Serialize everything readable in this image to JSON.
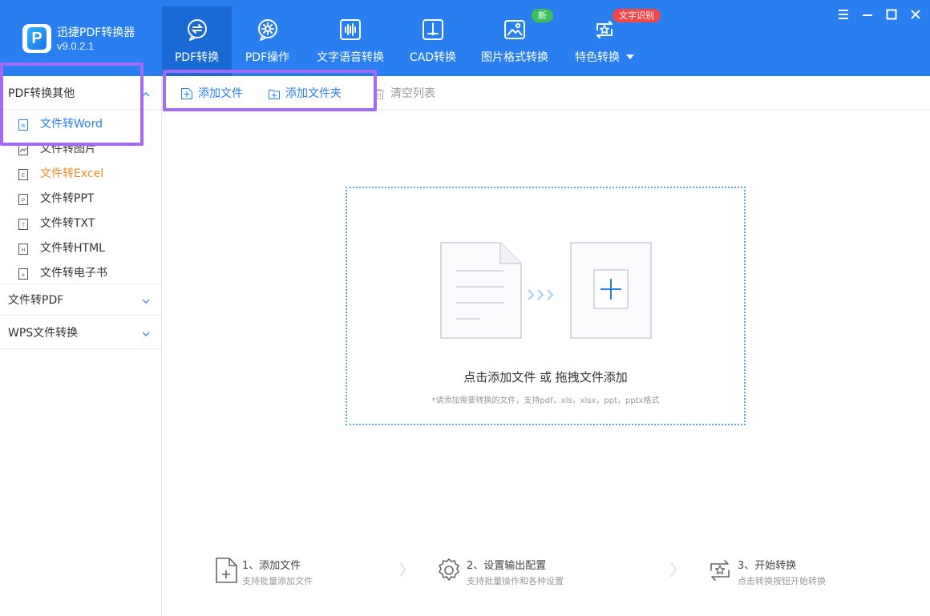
{
  "app": {
    "name": "迅捷PDF转换器",
    "version": "v9.0.2.1"
  },
  "nav": {
    "tabs": [
      {
        "label": "PDF转换",
        "active": true,
        "icon": "convert-icon"
      },
      {
        "label": "PDF操作",
        "active": false,
        "icon": "gear-icon"
      },
      {
        "label": "文字语音转换",
        "active": false,
        "icon": "audio-wave-icon"
      },
      {
        "label": "CAD转换",
        "active": false,
        "icon": "cad-icon"
      },
      {
        "label": "图片格式转换",
        "active": false,
        "icon": "image-icon",
        "badge": "新"
      },
      {
        "label": "特色转换",
        "active": false,
        "icon": "star-convert-icon",
        "badge": "文字识别",
        "dropdown": true
      }
    ]
  },
  "sidebar": {
    "groups": [
      {
        "label": "PDF转换其他",
        "expanded": true,
        "items": [
          {
            "label": "文件转Word",
            "icon": "word-doc-icon",
            "state": "selected"
          },
          {
            "label": "文件转图片",
            "icon": "image-doc-icon",
            "state": "normal"
          },
          {
            "label": "文件转Excel",
            "icon": "excel-doc-icon",
            "state": "hover"
          },
          {
            "label": "文件转PPT",
            "icon": "ppt-doc-icon",
            "state": "normal"
          },
          {
            "label": "文件转TXT",
            "icon": "txt-doc-icon",
            "state": "normal"
          },
          {
            "label": "文件转HTML",
            "icon": "html-doc-icon",
            "state": "normal"
          },
          {
            "label": "文件转电子书",
            "icon": "ebook-doc-icon",
            "state": "normal"
          }
        ]
      },
      {
        "label": "文件转PDF",
        "expanded": false,
        "items": []
      },
      {
        "label": "WPS文件转换",
        "expanded": false,
        "items": []
      }
    ]
  },
  "toolbar": {
    "add_file": "添加文件",
    "add_folder": "添加文件夹",
    "clear_list": "清空列表"
  },
  "dropzone": {
    "title": "点击添加文件 或 拖拽文件添加",
    "hint": "*请添加需要转换的文件，支持pdf，xls，xlsx，ppt，pptx格式"
  },
  "steps": [
    {
      "title": "1、添加文件",
      "subtitle": "支持批量添加文件",
      "icon": "add-file-icon"
    },
    {
      "title": "2、设置输出配置",
      "subtitle": "支持批量操作和各种设置",
      "icon": "settings-gear-icon"
    },
    {
      "title": "3、开始转换",
      "subtitle": "点击转换按钮开始转换",
      "icon": "start-convert-icon"
    }
  ],
  "colors": {
    "header_bg": "#2a7ff0",
    "active_tab_bg": "#1a6ad6",
    "selected_item": "#2a7ff0",
    "hover_item": "#f08a24",
    "highlight": "#a469f5",
    "badge_new": "#3cbf5a",
    "badge_ocr": "#f04848"
  }
}
